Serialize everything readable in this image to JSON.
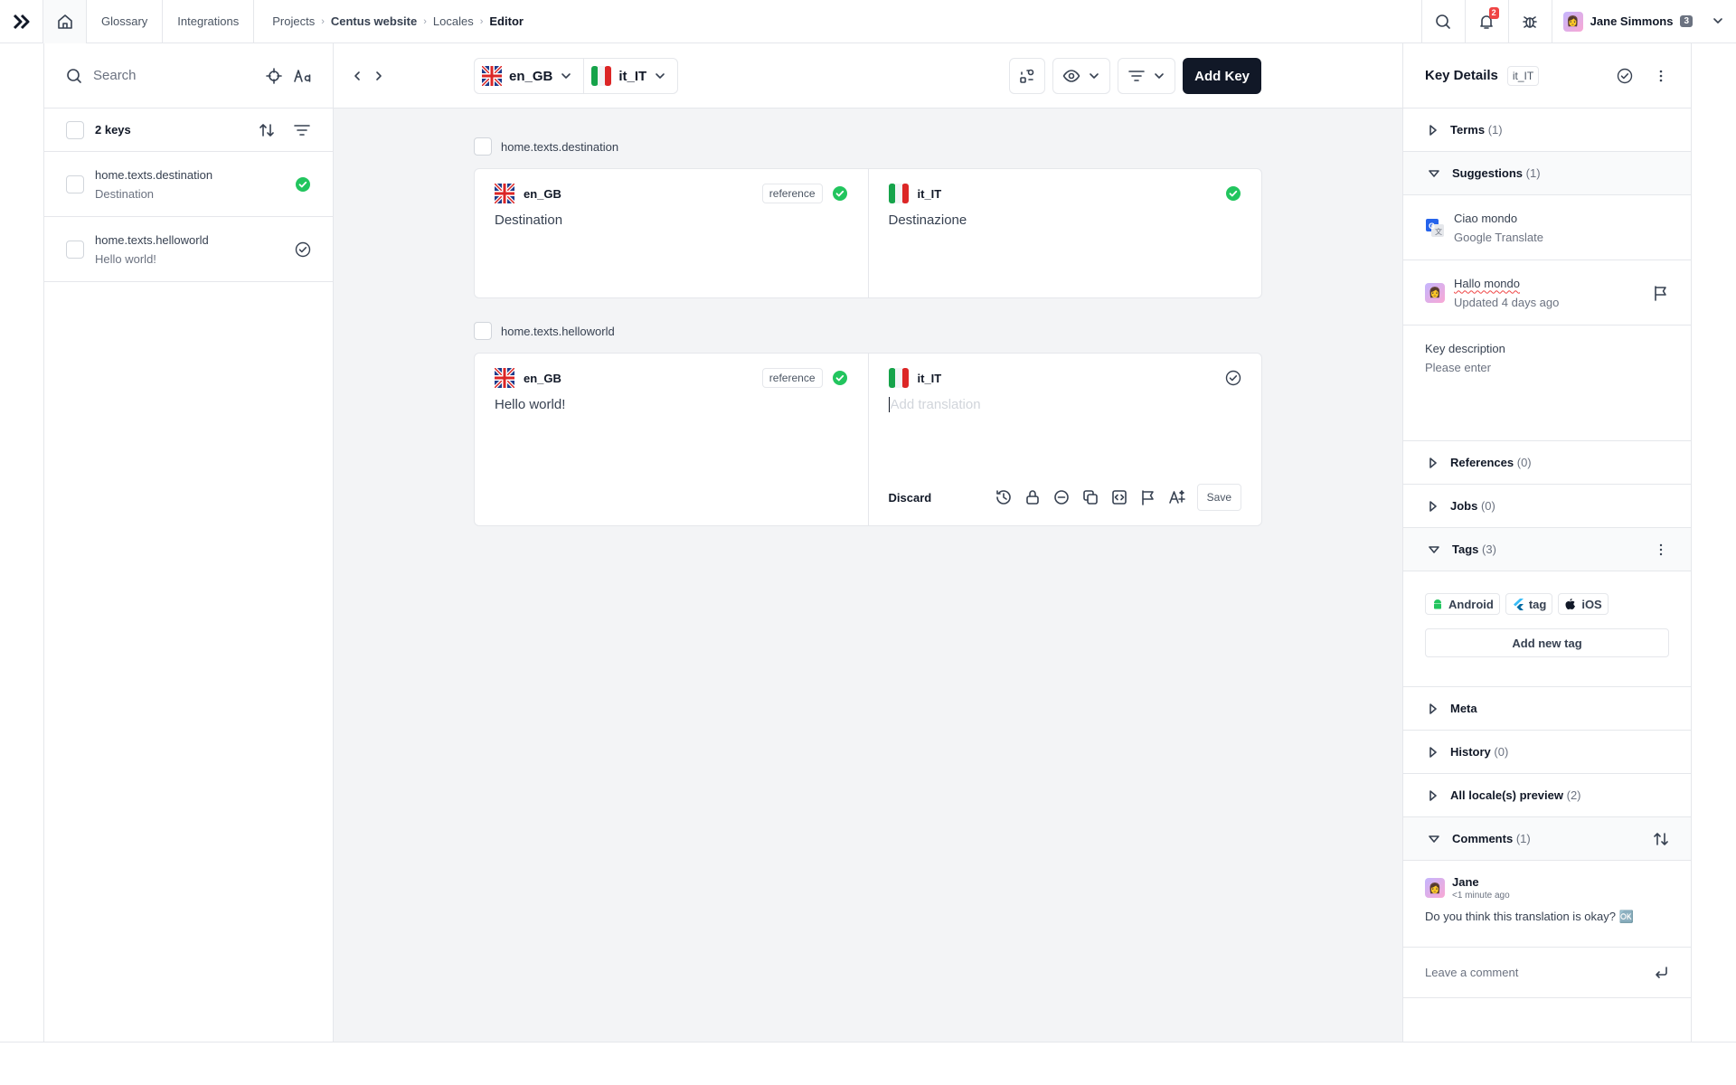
{
  "topbar": {
    "nav": [
      "Glossary",
      "Integrations"
    ],
    "breadcrumb": [
      "Projects",
      "Centus website",
      "Locales",
      "Editor"
    ],
    "notifications_count": "2",
    "user_name": "Jane Simmons",
    "user_count": "3"
  },
  "keys_panel": {
    "search_placeholder": "Search",
    "count_label": "2 keys",
    "items": [
      {
        "key": "home.texts.destination",
        "value": "Destination"
      },
      {
        "key": "home.texts.helloworld",
        "value": "Hello world!"
      }
    ]
  },
  "toolbar": {
    "source_locale": "en_GB",
    "target_locale": "it_IT",
    "add_key_label": "Add Key"
  },
  "editor": {
    "groups": [
      {
        "key": "home.texts.destination",
        "source_locale": "en_GB",
        "source_text": "Destination",
        "reference_label": "reference",
        "target_locale": "it_IT",
        "target_text": "Destinazione"
      },
      {
        "key": "home.texts.helloworld",
        "source_locale": "en_GB",
        "source_text": "Hello world!",
        "reference_label": "reference",
        "target_locale": "it_IT",
        "target_placeholder": "Add translation",
        "discard_label": "Discard",
        "save_label": "Save"
      }
    ]
  },
  "details": {
    "title": "Key Details",
    "locale": "it_IT",
    "sections": {
      "terms": {
        "label": "Terms",
        "count": "(1)"
      },
      "suggestions": {
        "label": "Suggestions",
        "count": "(1)"
      },
      "references": {
        "label": "References",
        "count": "(0)"
      },
      "jobs": {
        "label": "Jobs",
        "count": "(0)"
      },
      "tags": {
        "label": "Tags",
        "count": "(3)"
      },
      "meta": {
        "label": "Meta"
      },
      "history": {
        "label": "History",
        "count": "(0)"
      },
      "preview": {
        "label": "All locale(s) preview",
        "count": "(2)"
      },
      "comments": {
        "label": "Comments",
        "count": "(1)"
      }
    },
    "suggestions": [
      {
        "text": "Ciao mondo",
        "source": "Google Translate"
      },
      {
        "text": "Hallo mondo",
        "source": "Updated 4 days ago"
      }
    ],
    "key_description": {
      "label": "Key description",
      "placeholder": "Please enter"
    },
    "tags": [
      "Android",
      "tag",
      "iOS"
    ],
    "add_tag_label": "Add  new tag",
    "comment": {
      "author": "Jane",
      "time": "<1 minute ago",
      "text": "Do you think this translation is okay? 🆗"
    },
    "comment_placeholder": "Leave a comment"
  },
  "colors": {
    "accent": "#111827",
    "success": "#22c55e",
    "badge": "#ef4444"
  }
}
